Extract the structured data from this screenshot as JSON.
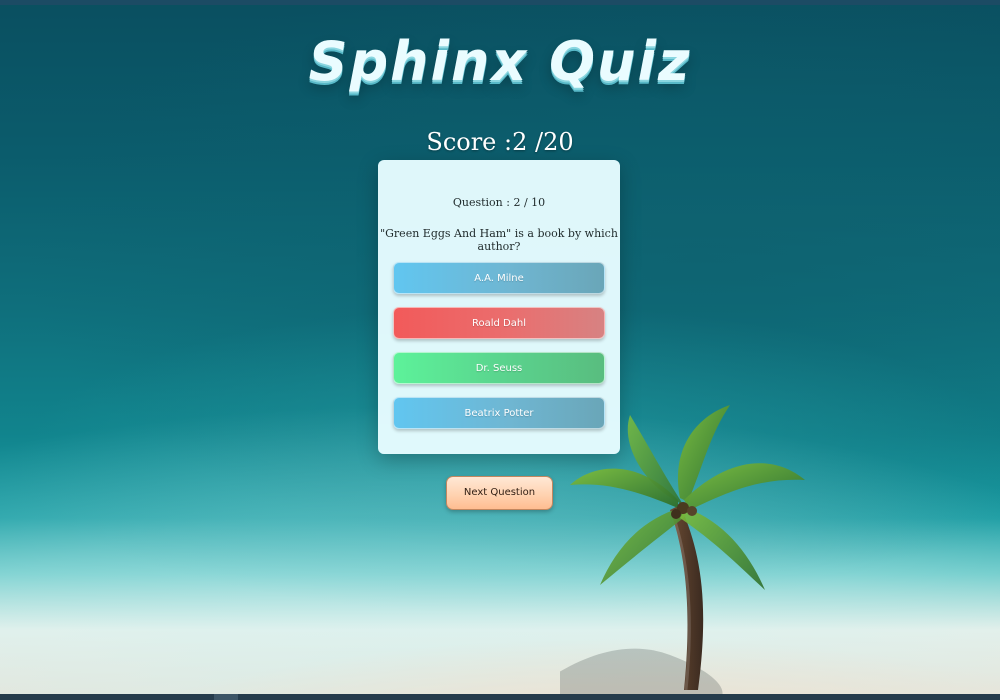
{
  "app": {
    "title": "Sphinx Quiz"
  },
  "score": {
    "text": "Score :2 /20"
  },
  "quiz": {
    "question_counter": "Question : 2 / 10",
    "question": "\"Green Eggs And Ham\" is a book by which author?",
    "options": [
      {
        "label": "A.A. Milne",
        "state": "neutral"
      },
      {
        "label": "Roald Dahl",
        "state": "incorrect"
      },
      {
        "label": "Dr. Seuss",
        "state": "correct"
      },
      {
        "label": "Beatrix Potter",
        "state": "neutral"
      }
    ],
    "next_button_label": "Next Question"
  },
  "theme": {
    "incorrect_color": "#f25a5a",
    "correct_color": "#5df29a",
    "neutral_color": "#61c6f0",
    "next_button_color": "#ffd3b1"
  }
}
